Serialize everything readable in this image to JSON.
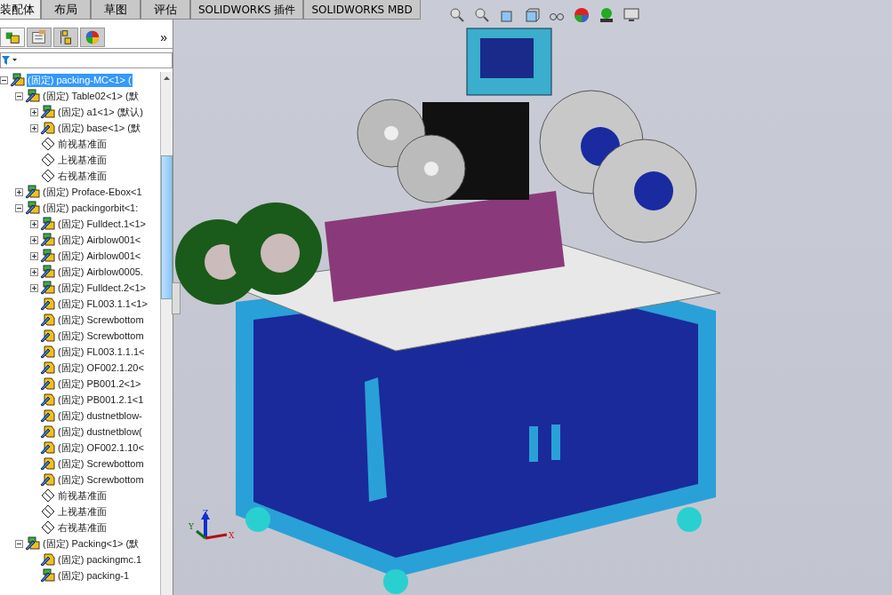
{
  "command_tabs": [
    {
      "label": "装配体",
      "selected": true
    },
    {
      "label": "布局",
      "selected": false
    },
    {
      "label": "草图",
      "selected": false
    },
    {
      "label": "评估",
      "selected": false
    },
    {
      "label": "SOLIDWORKS 插件",
      "selected": false
    },
    {
      "label": "SOLIDWORKS MBD",
      "selected": false
    }
  ],
  "panel_tabs": [
    {
      "kind": "feature-tree",
      "selected": true
    },
    {
      "kind": "property",
      "selected": false
    },
    {
      "kind": "config",
      "selected": false
    },
    {
      "kind": "display",
      "selected": false
    }
  ],
  "panel_more": "»",
  "tree": [
    {
      "label": "(固定) packing-MC<1> (",
      "kind": "assembly",
      "selected": true,
      "expanded": true,
      "children": [
        {
          "label": "(固定) Table02<1> (默",
          "kind": "assembly",
          "selected": false,
          "expanded": true,
          "children": [
            {
              "label": "(固定) a1<1> (默认)",
              "kind": "assembly",
              "selected": false,
              "expanded": false
            },
            {
              "label": "(固定) base<1> (默",
              "kind": "part",
              "selected": false,
              "expanded": false
            },
            {
              "label": "前视基准面",
              "kind": "plane",
              "selected": false
            },
            {
              "label": "上视基准面",
              "kind": "plane",
              "selected": false
            },
            {
              "label": "右视基准面",
              "kind": "plane",
              "selected": false
            }
          ]
        },
        {
          "label": "(固定) Proface-Ebox<1",
          "kind": "assembly",
          "selected": false,
          "expanded": false
        },
        {
          "label": "(固定) packingorbit<1:",
          "kind": "assembly",
          "selected": false,
          "expanded": true,
          "children": [
            {
              "label": "(固定) Fulldect.1<1>",
              "kind": "assembly",
              "selected": false,
              "expanded": false
            },
            {
              "label": "(固定) Airblow001<",
              "kind": "assembly",
              "selected": false,
              "expanded": false
            },
            {
              "label": "(固定) Airblow001<",
              "kind": "assembly",
              "selected": false,
              "expanded": false
            },
            {
              "label": "(固定) Airblow0005.",
              "kind": "assembly",
              "selected": false,
              "expanded": false
            },
            {
              "label": "(固定) Fulldect.2<1>",
              "kind": "assembly",
              "selected": false,
              "expanded": false
            },
            {
              "label": "(固定) FL003.1.1<1>",
              "kind": "part",
              "selected": false
            },
            {
              "label": "(固定) Screwbottom",
              "kind": "part",
              "selected": false
            },
            {
              "label": "(固定) Screwbottom",
              "kind": "part",
              "selected": false
            },
            {
              "label": "(固定) FL003.1.1.1<",
              "kind": "part",
              "selected": false
            },
            {
              "label": "(固定) OF002.1.20<",
              "kind": "part",
              "selected": false
            },
            {
              "label": "(固定) PB001.2<1>",
              "kind": "part",
              "selected": false
            },
            {
              "label": "(固定) PB001.2.1<1",
              "kind": "part",
              "selected": false
            },
            {
              "label": "(固定) dustnetblow-",
              "kind": "part",
              "selected": false
            },
            {
              "label": "(固定) dustnetblow(",
              "kind": "part",
              "selected": false
            },
            {
              "label": "(固定) OF002.1.10<",
              "kind": "part",
              "selected": false
            },
            {
              "label": "(固定) Screwbottom",
              "kind": "part",
              "selected": false
            },
            {
              "label": "(固定) Screwbottom",
              "kind": "part",
              "selected": false
            },
            {
              "label": "前视基准面",
              "kind": "plane",
              "selected": false
            },
            {
              "label": "上视基准面",
              "kind": "plane",
              "selected": false
            },
            {
              "label": "右视基准面",
              "kind": "plane",
              "selected": false
            }
          ]
        },
        {
          "label": "(固定) Packing<1> (默",
          "kind": "assembly",
          "selected": false,
          "expanded": true,
          "children": [
            {
              "label": "(固定) packingmc.1",
              "kind": "part",
              "selected": false
            },
            {
              "label": "(固定) packing-1",
              "kind": "assembly",
              "selected": false
            }
          ]
        }
      ]
    }
  ],
  "triad": {
    "x": "X",
    "y": "Y",
    "z": "Z"
  }
}
